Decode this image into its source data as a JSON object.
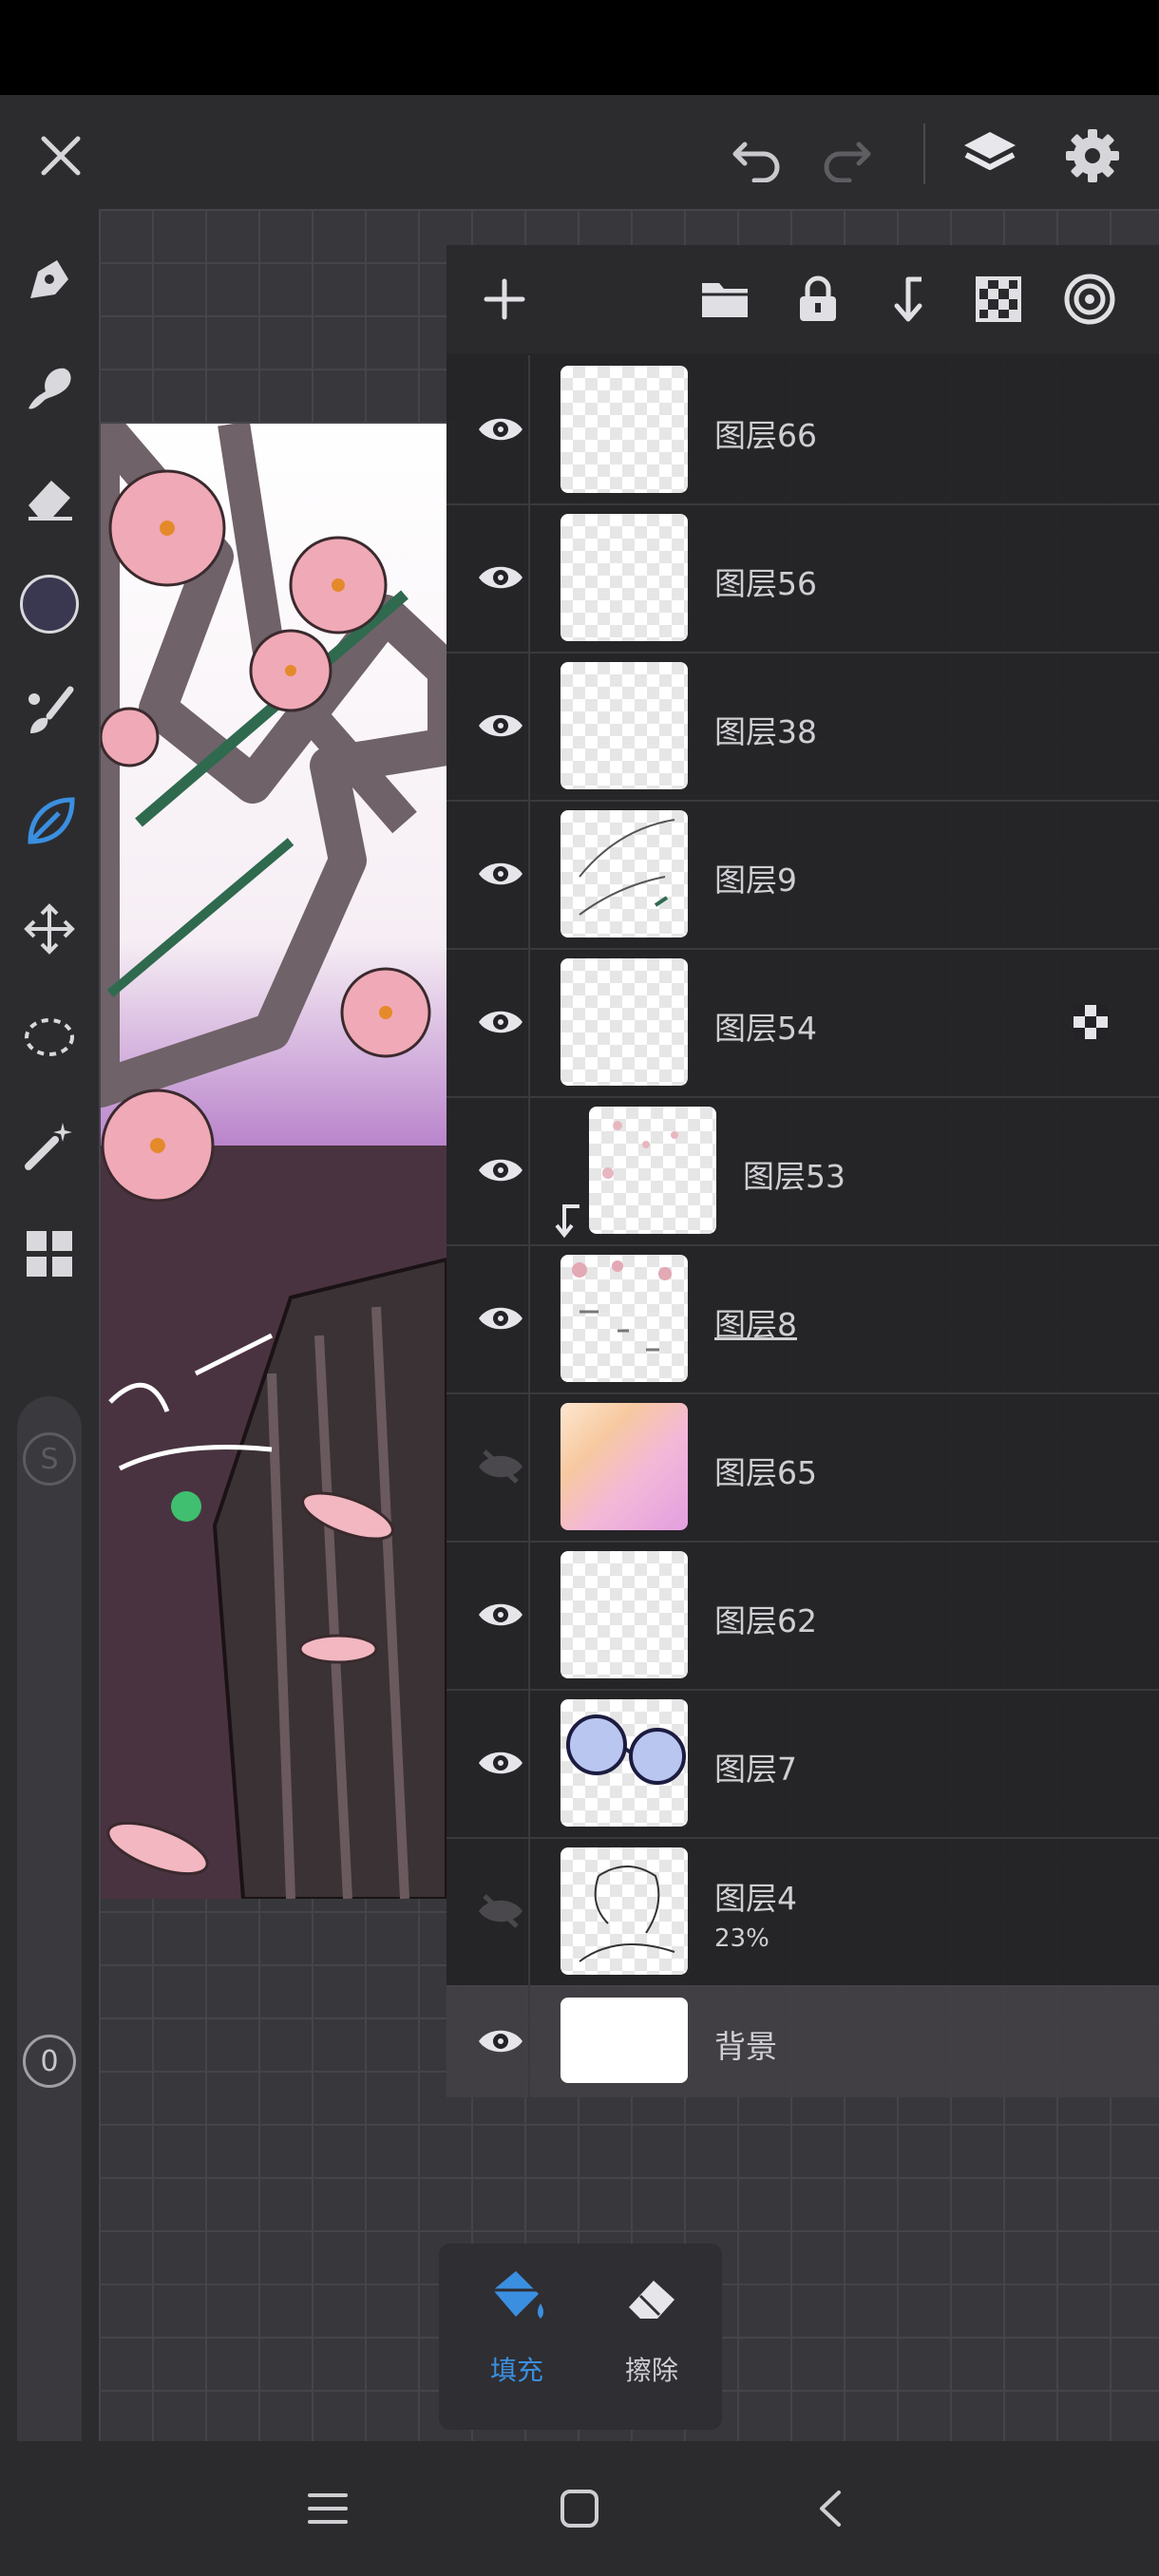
{
  "toolbar_top": {
    "close": "close-icon",
    "undo": "undo-icon",
    "redo": "redo-icon",
    "layers": "layers-icon",
    "settings": "gear-icon"
  },
  "left_tools": [
    {
      "name": "pen-tool",
      "icon": "pen-icon"
    },
    {
      "name": "smudge-tool",
      "icon": "smudge-icon"
    },
    {
      "name": "eraser-tool",
      "icon": "eraser-icon"
    },
    {
      "name": "color-swatch",
      "icon": "color-circle",
      "color": "#3a3850"
    },
    {
      "name": "brush-tool",
      "icon": "brush-icon"
    },
    {
      "name": "fill-tool",
      "icon": "leaf-icon",
      "active": true
    },
    {
      "name": "move-tool",
      "icon": "move-icon"
    },
    {
      "name": "lasso-tool",
      "icon": "lasso-icon"
    },
    {
      "name": "magic-wand-tool",
      "icon": "wand-icon"
    },
    {
      "name": "grid-tool",
      "icon": "grid-icon"
    }
  ],
  "side_slider_top_label": "S",
  "side_slider_bottom_label": "0",
  "panel_toolbar": [
    "add-icon",
    "folder-icon",
    "lock-icon",
    "merge-down-icon",
    "checker-icon",
    "target-icon"
  ],
  "layers": [
    {
      "name": "图层66",
      "visible": true
    },
    {
      "name": "图层56",
      "visible": true
    },
    {
      "name": "图层38",
      "visible": true
    },
    {
      "name": "图层9",
      "visible": true
    },
    {
      "name": "图层54",
      "visible": true,
      "alpha_lock": true
    },
    {
      "name": "图层53",
      "visible": true,
      "clipped": true
    },
    {
      "name": "图层8",
      "visible": true,
      "underlined": true
    },
    {
      "name": "图层65",
      "visible": false
    },
    {
      "name": "图层62",
      "visible": true
    },
    {
      "name": "图层7",
      "visible": true
    },
    {
      "name": "图层4",
      "visible": false,
      "opacity": "23%"
    },
    {
      "name": "背景",
      "visible": true,
      "selected": true
    }
  ],
  "bottom_popup": {
    "fill_label": "填充",
    "erase_label": "擦除"
  },
  "colors": {
    "accent": "#3b8fe0",
    "panel": "#2a292c",
    "text": "#cfcfd3"
  }
}
